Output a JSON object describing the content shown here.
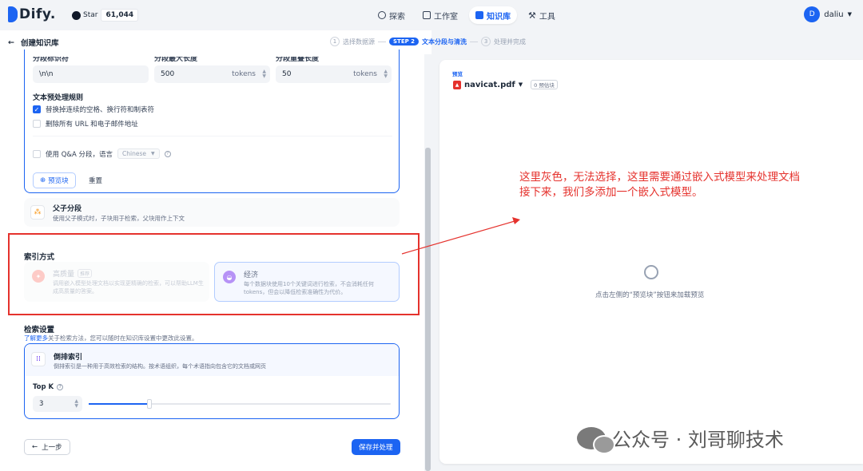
{
  "brand": {
    "name": "Dify."
  },
  "github": {
    "label": "Star",
    "count": "61,044"
  },
  "nav": [
    {
      "label": "探索"
    },
    {
      "label": "工作室"
    },
    {
      "label": "知识库"
    },
    {
      "label": "工具"
    }
  ],
  "user": {
    "initial": "D",
    "name": "daliu"
  },
  "breadcrumb": {
    "title": "创建知识库"
  },
  "steps": {
    "s1_num": "1",
    "s1_label": "选择数据源",
    "s2_num": "STEP 2",
    "s2_label": "文本分段与清洗",
    "s3_num": "3",
    "s3_label": "处理并完成"
  },
  "segment": {
    "delimiter_label": "分段标识符",
    "delimiter_value": "\\n\\n",
    "maxlen_label": "分段最大长度",
    "maxlen_value": "500",
    "overlap_label": "分段重叠长度",
    "overlap_value": "50",
    "unit": "tokens",
    "preprocess_title": "文本预处理规则",
    "rule1": "替换掉连续的空格、换行符和制表符",
    "rule2": "删除所有 URL 和电子邮件地址",
    "qa_label": "使用 Q&A 分段，语言",
    "qa_lang": "Chinese",
    "preview_btn": "预览块",
    "reset_btn": "重置"
  },
  "parent_child": {
    "title": "父子分段",
    "desc": "使用父子模式时，子块用于检索，父块用作上下文"
  },
  "index": {
    "title": "索引方式",
    "hq_name": "高质量",
    "hq_tag": "推荐",
    "hq_desc": "调用嵌入模型处理文档以实现更精确的检索，可以帮助LLM生成高质量的答案。",
    "eco_name": "经济",
    "eco_desc": "每个数据块使用10个关键词进行检索，不会消耗任何 tokens，但会以降低检索准确性为代价。"
  },
  "retrieval": {
    "title": "检索设置",
    "learn_more": "了解更多",
    "sub": "关于检索方法，您可以随时在知识库设置中更改此设置。",
    "method_name": "倒排索引",
    "method_desc": "倒排索引是一种用于高效检索的结构。按术语组织，每个术语指向包含它的文档或网页",
    "topk_label": "Top K",
    "topk_value": "3",
    "topk_max": 10
  },
  "footer": {
    "prev": "上一步",
    "save": "保存并处理"
  },
  "preview": {
    "label": "预览",
    "file": "navicat.pdf",
    "count": "0 预估块",
    "empty": "点击左侧的“预览块”按钮来加载预览"
  },
  "annotation": {
    "line1": "这里灰色，无法选择，这里需要通过嵌入式模型来处理文档",
    "line2": "接下来，我们多添加一个嵌入式模型。"
  },
  "watermark": {
    "text": "公众号 · 刘哥聊技术"
  },
  "colors": {
    "primary": "#1c64f2",
    "annotation": "#e5322d"
  }
}
